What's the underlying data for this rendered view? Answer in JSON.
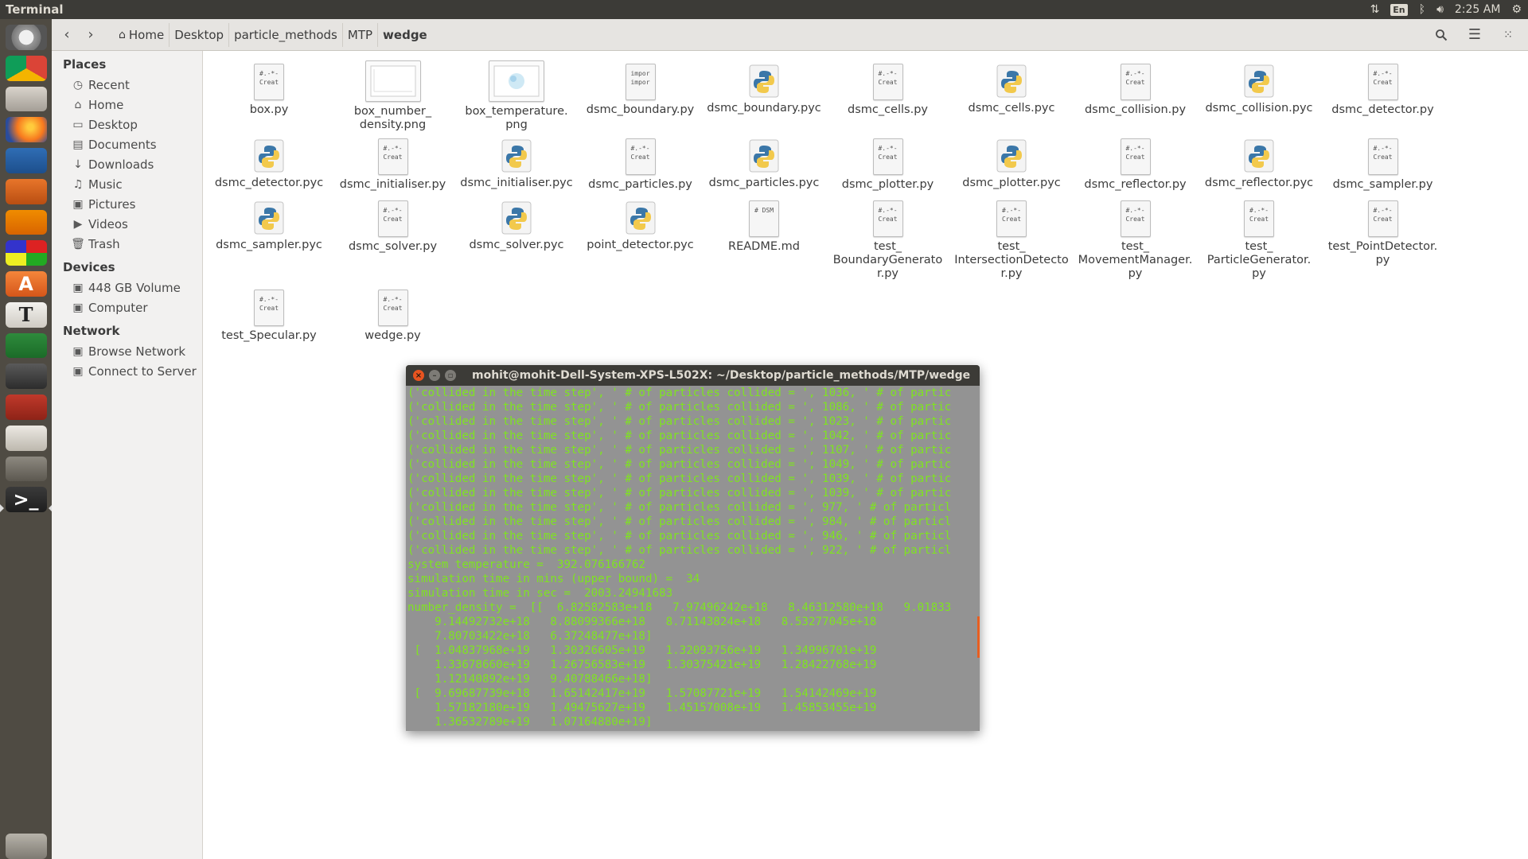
{
  "top_panel": {
    "app_title": "Terminal",
    "lang": "En",
    "time": "2:25 AM"
  },
  "launcher": [
    {
      "name": "dash-home-icon"
    },
    {
      "name": "chrome-icon"
    },
    {
      "name": "removable-drive-icon"
    },
    {
      "name": "firefox-icon"
    },
    {
      "name": "writer-icon"
    },
    {
      "name": "impress-icon"
    },
    {
      "name": "vlc-icon"
    },
    {
      "name": "workspace-switcher-icon"
    },
    {
      "name": "software-center-icon"
    },
    {
      "name": "texmaker-icon"
    },
    {
      "name": "calc-icon"
    },
    {
      "name": "video-editor-icon"
    },
    {
      "name": "wireshark-icon"
    },
    {
      "name": "text-editor-icon"
    },
    {
      "name": "gimp-icon"
    },
    {
      "name": "terminal-icon"
    },
    {
      "name": "trash-icon"
    }
  ],
  "breadcrumbs": [
    "Home",
    "Desktop",
    "particle_methods",
    "MTP",
    "wedge"
  ],
  "sidebar": {
    "places_heading": "Places",
    "places": [
      "Recent",
      "Home",
      "Desktop",
      "Documents",
      "Downloads",
      "Music",
      "Pictures",
      "Videos",
      "Trash"
    ],
    "devices_heading": "Devices",
    "devices": [
      "448 GB Volume",
      "Computer"
    ],
    "network_heading": "Network",
    "network": [
      "Browse Network",
      "Connect to Server"
    ]
  },
  "files": [
    {
      "name": "box.py",
      "type": "script",
      "preview": [
        "#.-*-",
        "Creat"
      ]
    },
    {
      "name": "box_number_density.png",
      "type": "image",
      "preview": []
    },
    {
      "name": "box_temperature.png",
      "type": "image",
      "preview": []
    },
    {
      "name": "dsmc_boundary.py",
      "type": "script",
      "preview": [
        "impor",
        "impor"
      ]
    },
    {
      "name": "dsmc_boundary.pyc",
      "type": "pyc",
      "preview": []
    },
    {
      "name": "dsmc_cells.py",
      "type": "script",
      "preview": [
        "#.-*-",
        "Creat"
      ]
    },
    {
      "name": "dsmc_cells.pyc",
      "type": "pyc",
      "preview": []
    },
    {
      "name": "dsmc_collision.py",
      "type": "script",
      "preview": [
        "#.-*-",
        "Creat"
      ]
    },
    {
      "name": "dsmc_collision.pyc",
      "type": "pyc",
      "preview": []
    },
    {
      "name": "dsmc_detector.py",
      "type": "script",
      "preview": [
        "#.-*-",
        "Creat"
      ]
    },
    {
      "name": "dsmc_detector.pyc",
      "type": "pyc",
      "preview": []
    },
    {
      "name": "dsmc_initialiser.py",
      "type": "script",
      "preview": [
        "#.-*-",
        "Creat"
      ]
    },
    {
      "name": "dsmc_initialiser.pyc",
      "type": "pyc",
      "preview": []
    },
    {
      "name": "dsmc_particles.py",
      "type": "script",
      "preview": [
        "#.-*-",
        "Creat"
      ]
    },
    {
      "name": "dsmc_particles.pyc",
      "type": "pyc",
      "preview": []
    },
    {
      "name": "dsmc_plotter.py",
      "type": "script",
      "preview": [
        "#.-*-",
        "Creat"
      ]
    },
    {
      "name": "dsmc_plotter.pyc",
      "type": "pyc",
      "preview": []
    },
    {
      "name": "dsmc_reflector.py",
      "type": "script",
      "preview": [
        "#.-*-",
        "Creat"
      ]
    },
    {
      "name": "dsmc_reflector.pyc",
      "type": "pyc",
      "preview": []
    },
    {
      "name": "dsmc_sampler.py",
      "type": "script",
      "preview": [
        "#.-*-",
        "Creat"
      ]
    },
    {
      "name": "dsmc_sampler.pyc",
      "type": "pyc",
      "preview": []
    },
    {
      "name": "dsmc_solver.py",
      "type": "script",
      "preview": [
        "#.-*-",
        "Creat"
      ]
    },
    {
      "name": "dsmc_solver.pyc",
      "type": "pyc",
      "preview": []
    },
    {
      "name": "point_detector.pyc",
      "type": "pyc",
      "preview": []
    },
    {
      "name": "README.md",
      "type": "script",
      "preview": [
        "# DSM",
        ""
      ]
    },
    {
      "name": "test_BoundaryGenerator.py",
      "type": "script",
      "preview": [
        "#.-*-",
        "Creat"
      ]
    },
    {
      "name": "test_IntersectionDetector.py",
      "type": "script",
      "preview": [
        "#.-*-",
        "Creat"
      ]
    },
    {
      "name": "test_MovementManager.py",
      "type": "script",
      "preview": [
        "#.-*-",
        "Creat"
      ]
    },
    {
      "name": "test_ParticleGenerator.py",
      "type": "script",
      "preview": [
        "#.-*-",
        "Creat"
      ]
    },
    {
      "name": "test_PointDetector.py",
      "type": "script",
      "preview": [
        "#.-*-",
        "Creat"
      ]
    },
    {
      "name": "test_Specular.py",
      "type": "script",
      "preview": [
        "#.-*-",
        "Creat"
      ]
    },
    {
      "name": "wedge.py",
      "type": "script",
      "preview": [
        "#.-*-",
        "Creat"
      ]
    }
  ],
  "file_labels": [
    "box.py",
    "box_number_\ndensity.png",
    "box_temperature.\npng",
    "dsmc_boundary.py",
    "dsmc_boundary.pyc",
    "dsmc_cells.py",
    "dsmc_cells.pyc",
    "dsmc_collision.py",
    "dsmc_collision.pyc",
    "dsmc_detector.py",
    "dsmc_detector.pyc",
    "dsmc_initialiser.py",
    "dsmc_initialiser.pyc",
    "dsmc_particles.py",
    "dsmc_particles.pyc",
    "dsmc_plotter.py",
    "dsmc_plotter.pyc",
    "dsmc_reflector.py",
    "dsmc_reflector.pyc",
    "dsmc_sampler.py",
    "dsmc_sampler.pyc",
    "dsmc_solver.py",
    "dsmc_solver.pyc",
    "point_detector.pyc",
    "README.md",
    "test_\nBoundaryGenerato\nr.py",
    "test_\nIntersectionDetecto\nr.py",
    "test_\nMovementManager.\npy",
    "test_\nParticleGenerator.\npy",
    "test_PointDetector.\npy",
    "test_Specular.py",
    "wedge.py"
  ],
  "terminal": {
    "title": "mohit@mohit-Dell-System-XPS-L502X: ~/Desktop/particle_methods/MTP/wedge",
    "lines": [
      "('collided in the time step', ' # of particles collided = ', 1036, ' # of partic",
      "('collided in the time step', ' # of particles collided = ', 1086, ' # of partic",
      "('collided in the time step', ' # of particles collided = ', 1023, ' # of partic",
      "('collided in the time step', ' # of particles collided = ', 1042, ' # of partic",
      "('collided in the time step', ' # of particles collided = ', 1107, ' # of partic",
      "('collided in the time step', ' # of particles collided = ', 1049, ' # of partic",
      "('collided in the time step', ' # of particles collided = ', 1039, ' # of partic",
      "('collided in the time step', ' # of particles collided = ', 1039, ' # of partic",
      "('collided in the time step', ' # of particles collided = ', 977, ' # of particl",
      "('collided in the time step', ' # of particles collided = ', 984, ' # of particl",
      "('collided in the time step', ' # of particles collided = ', 946, ' # of particl",
      "('collided in the time step', ' # of particles collided = ', 922, ' # of particl",
      "system temperature =  392.076166762",
      "simulation time in mins (upper bound) =  34",
      "simulation time in sec =  2003.24941683",
      "number_density =  [[  6.82582583e+18   7.97496242e+18   8.46312580e+18   9.01833",
      "    9.14492732e+18   8.88099366e+18   8.71143824e+18   8.53277045e+18",
      "    7.80703422e+18   6.37248477e+18]",
      " [  1.04837968e+19   1.30326605e+19   1.32093756e+19   1.34996701e+19",
      "    1.33678660e+19   1.26756583e+19   1.30375421e+19   1.28422768e+19",
      "    1.12140892e+19   9.40788466e+18]",
      " [  9.69687739e+18   1.65142417e+19   1.57087721e+19   1.54142469e+19",
      "    1.57182180e+19   1.49475627e+19   1.45157008e+19   1.45853455e+19",
      "    1.36532789e+19   1.07164880e+19]"
    ]
  }
}
